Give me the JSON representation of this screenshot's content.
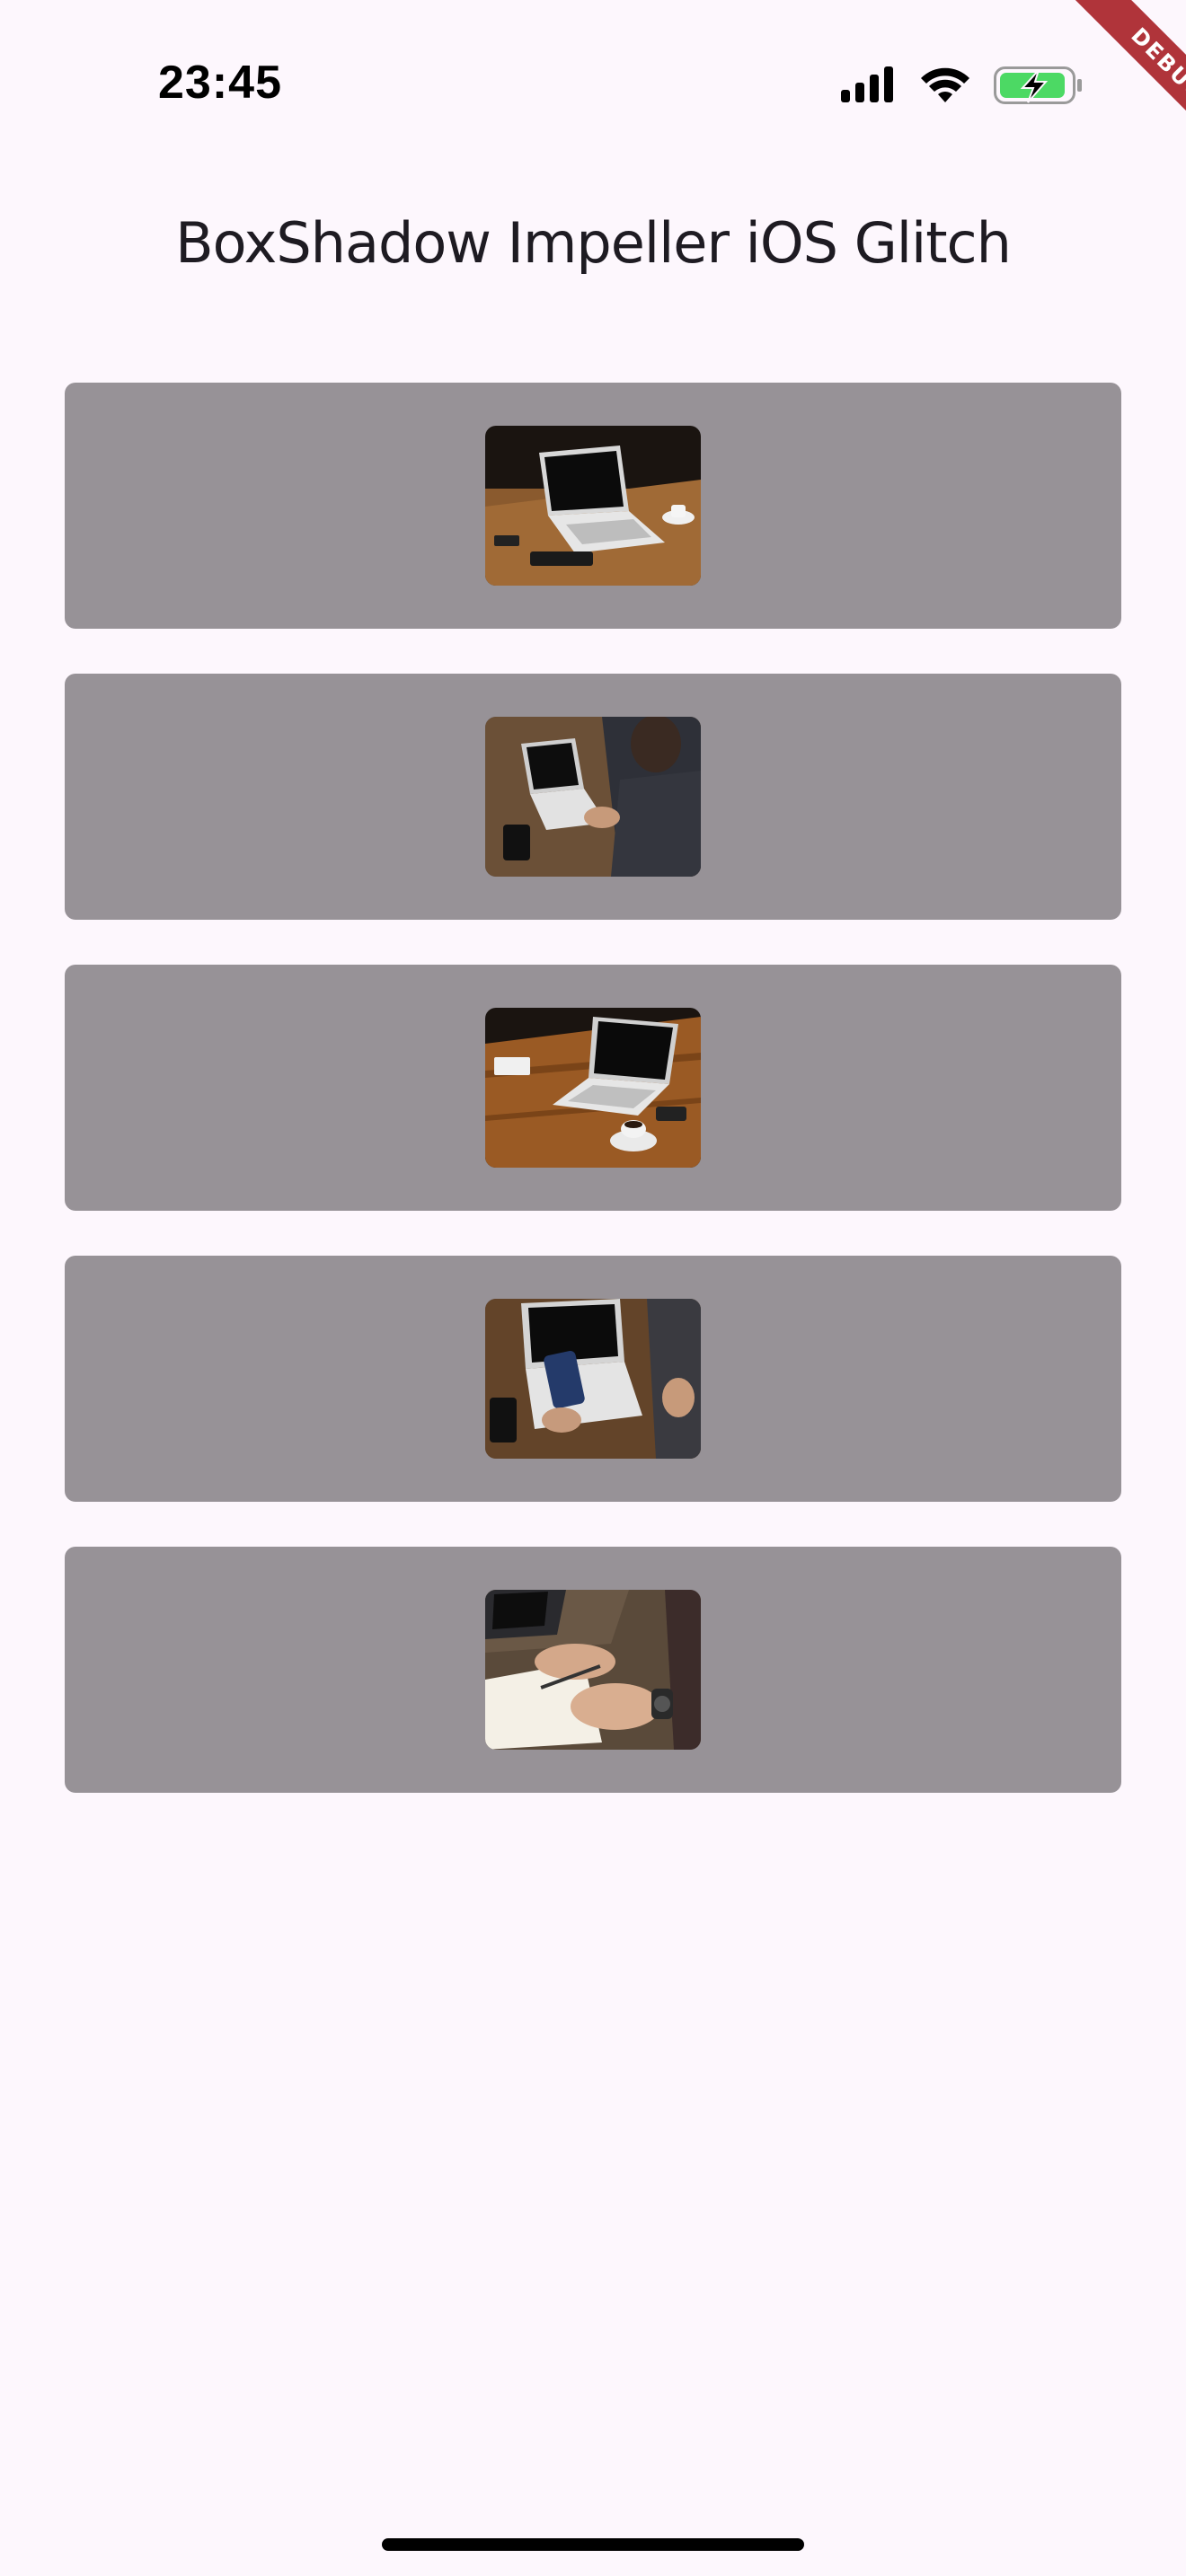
{
  "status_bar": {
    "time": "23:45",
    "icons": [
      "cellular-signal-icon",
      "wifi-icon",
      "battery-charging-icon"
    ],
    "battery_color": "#4cd964"
  },
  "debug_banner": {
    "label": "DEBUG",
    "color": "#b0343a"
  },
  "app": {
    "title": "BoxShadow Impeller iOS Glitch",
    "background": "#fdf7fd",
    "card_color": "#979297"
  },
  "cards": [
    {
      "image": "laptop-on-wooden-desk-with-coffee"
    },
    {
      "image": "person-typing-on-laptop"
    },
    {
      "image": "laptop-with-coffee-cup-on-table"
    },
    {
      "image": "person-holding-phone-at-laptop"
    },
    {
      "image": "hands-writing-in-notebook-with-watch"
    }
  ]
}
